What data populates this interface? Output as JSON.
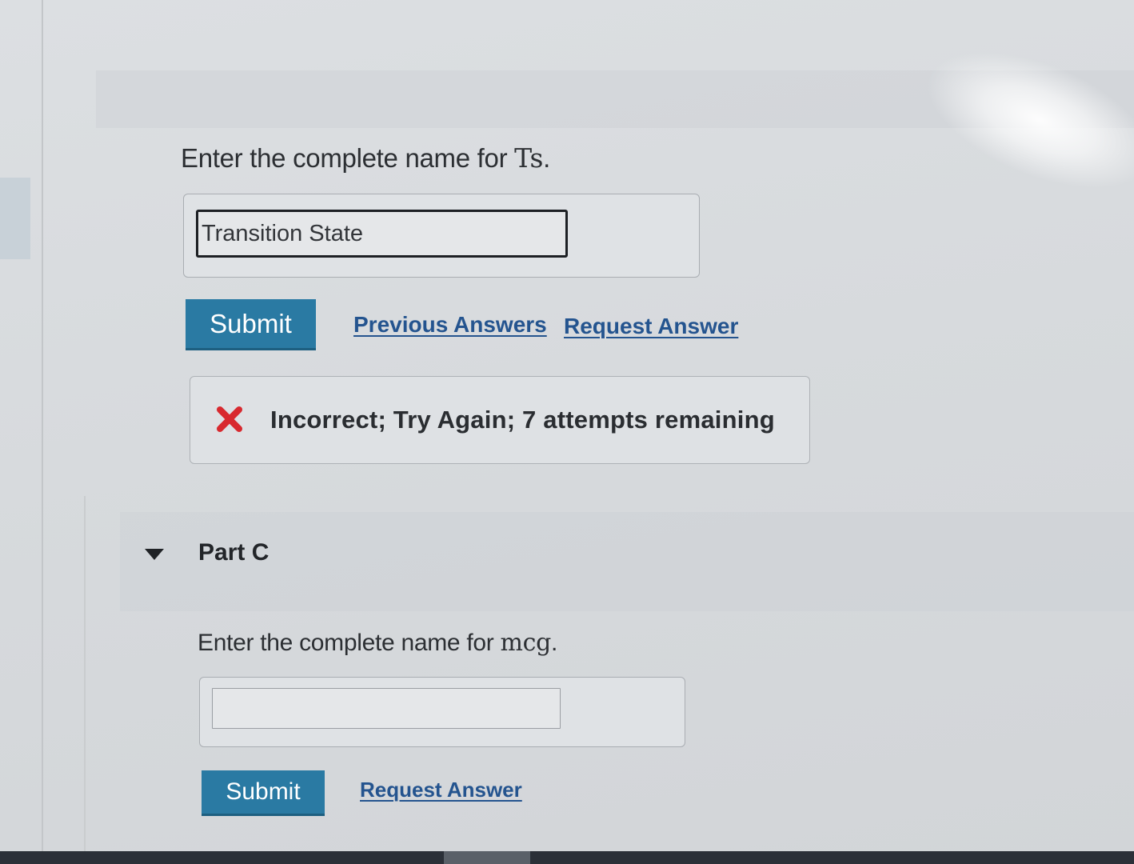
{
  "part_b": {
    "prompt_text": "Enter the complete name for ",
    "prompt_symbol": "Ts",
    "prompt_end": ".",
    "answer_value": "Transition State",
    "submit_label": "Submit",
    "previous_answers_label": "Previous Answers",
    "request_answer_label": "Request Answer",
    "feedback_text": "Incorrect; Try Again; 7 attempts remaining",
    "feedback_icon": "x-icon",
    "feedback_color": "#d8292f"
  },
  "part_c": {
    "title": "Part C",
    "prompt_text": "Enter the complete name for ",
    "prompt_symbol": "mcg",
    "prompt_end": ".",
    "answer_value": "",
    "submit_label": "Submit",
    "request_answer_label": "Request Answer"
  },
  "colors": {
    "button": "#2a7aa3",
    "link": "#24548f"
  }
}
